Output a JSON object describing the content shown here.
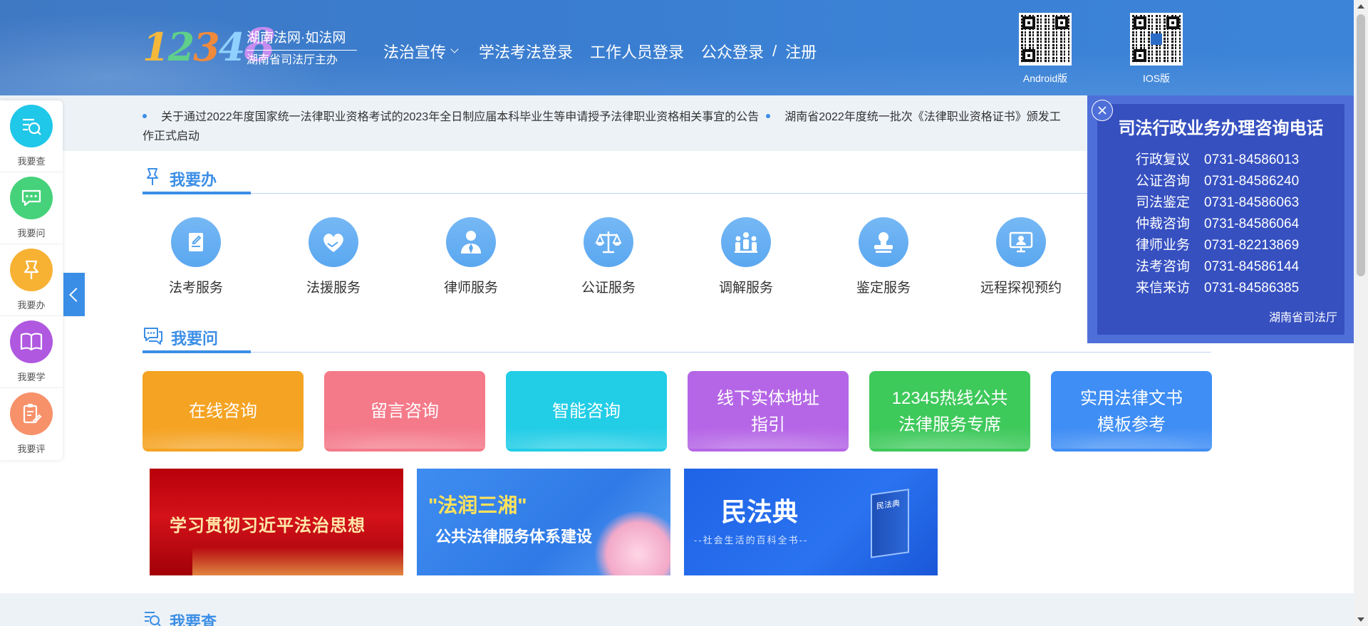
{
  "header": {
    "logo": {
      "number": "12348",
      "line1": "湖南法网·如法网",
      "line2": "湖南省司法厅主办"
    },
    "nav": [
      {
        "label": "法治宣传",
        "has_dropdown": true
      },
      {
        "label": "学法考法登录"
      },
      {
        "label": "工作人员登录"
      },
      {
        "label": "公众登录"
      },
      {
        "label": "/"
      },
      {
        "label": "注册"
      }
    ],
    "qr": [
      {
        "label": "Android版"
      },
      {
        "label": "IOS版"
      }
    ]
  },
  "notice": {
    "items": [
      "关于通过2022年度国家统一法律职业资格考试的2023年全日制应届本科毕业生等申请授予法律职业资格相关事宜的公告",
      "湖南省2022年度统一批次《法律职业资格证书》颁发工作正式启动"
    ]
  },
  "sections": {
    "do": {
      "title": "我要办",
      "services": [
        {
          "label": "法考服务",
          "icon": "document-pen-icon"
        },
        {
          "label": "法援服务",
          "icon": "heart-handshake-icon"
        },
        {
          "label": "律师服务",
          "icon": "lawyer-person-icon"
        },
        {
          "label": "公证服务",
          "icon": "scales-icon"
        },
        {
          "label": "调解服务",
          "icon": "mediation-people-icon"
        },
        {
          "label": "鉴定服务",
          "icon": "stamp-icon"
        },
        {
          "label": "远程探视预约",
          "icon": "video-monitor-icon"
        }
      ]
    },
    "ask": {
      "title": "我要问",
      "cards": [
        {
          "label": "在线咨询",
          "color": "#f5a323"
        },
        {
          "label": "留言咨询",
          "color": "#f47a8a"
        },
        {
          "label": "智能咨询",
          "color": "#22cde6"
        },
        {
          "label": "线下实体地址\n指引",
          "color": "#b566e6"
        },
        {
          "label": "12345热线公共\n法律服务专席",
          "color": "#3ec95b"
        },
        {
          "label": "实用法律文书\n模板参考",
          "color": "#3f8ef5"
        }
      ]
    },
    "banners": {
      "b1": {
        "text": "学习贯彻习近平法治思想"
      },
      "b2": {
        "line1": "\"法润三湘\"",
        "line2": "公共法律服务体系建设"
      },
      "b3": {
        "line1": "民法典",
        "line2": "--社会生活的百科全书--",
        "book": "民法典"
      }
    },
    "check": {
      "title": "我要查"
    }
  },
  "left_float": {
    "items": [
      {
        "label": "我要查",
        "icon": "search-list-icon",
        "color": "#1fc7e8"
      },
      {
        "label": "我要问",
        "icon": "chat-bubble-icon",
        "color": "#45d27a"
      },
      {
        "label": "我要办",
        "icon": "pin-icon",
        "color": "#f7b234"
      },
      {
        "label": "我要学",
        "icon": "book-icon",
        "color": "#b058e0"
      },
      {
        "label": "我要评",
        "icon": "clipboard-pen-icon",
        "color": "#f7916a"
      }
    ]
  },
  "right_float": {
    "title": "司法行政业务办理咨询电话",
    "rows": [
      {
        "k": "行政复议",
        "v": "0731-84586013"
      },
      {
        "k": "公证咨询",
        "v": "0731-84586240"
      },
      {
        "k": "司法鉴定",
        "v": "0731-84586063"
      },
      {
        "k": "仲裁咨询",
        "v": "0731-84586064"
      },
      {
        "k": "律师业务",
        "v": "0731-82213869"
      },
      {
        "k": "法考咨询",
        "v": "0731-84586144"
      },
      {
        "k": "来信来访",
        "v": "0731-84586385"
      }
    ],
    "footer": "湖南省司法厅"
  }
}
